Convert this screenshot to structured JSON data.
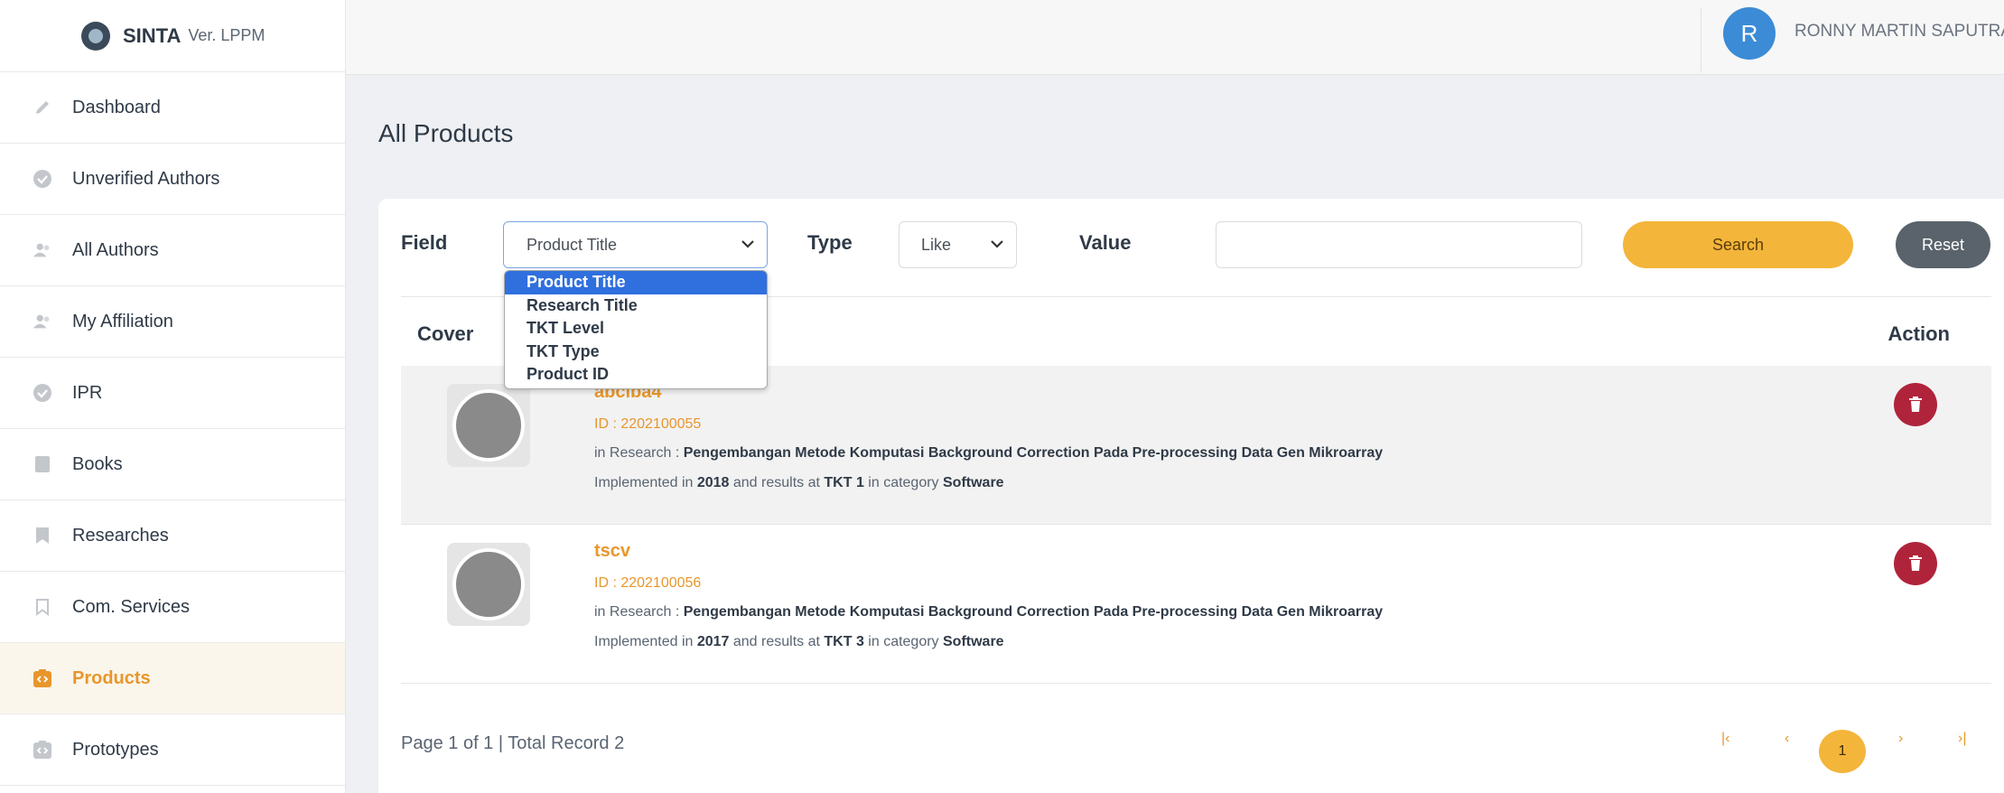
{
  "brand": {
    "name": "SINTA",
    "version": "Ver. LPPM"
  },
  "sidebar": {
    "items": [
      {
        "label": "Dashboard",
        "icon": "pencil-icon"
      },
      {
        "label": "Unverified Authors",
        "icon": "badge-check-icon"
      },
      {
        "label": "All Authors",
        "icon": "users-icon"
      },
      {
        "label": "My Affiliation",
        "icon": "users-icon"
      },
      {
        "label": "IPR",
        "icon": "badge-check-icon"
      },
      {
        "label": "Books",
        "icon": "book-icon"
      },
      {
        "label": "Researches",
        "icon": "bookmark-icon"
      },
      {
        "label": "Com. Services",
        "icon": "bookmark-outline-icon"
      },
      {
        "label": "Products",
        "icon": "code-box-icon",
        "active": true
      },
      {
        "label": "Prototypes",
        "icon": "code-box-icon"
      }
    ]
  },
  "header": {
    "avatar_letter": "R",
    "user_name": "RONNY MARTIN SAPUTRA,"
  },
  "page": {
    "title": "All Products"
  },
  "filter": {
    "field_label": "Field",
    "field_value": "Product Title",
    "field_options": [
      "Product Title",
      "Research Title",
      "TKT Level",
      "TKT Type",
      "Product ID"
    ],
    "type_label": "Type",
    "type_value": "Like",
    "value_label": "Value",
    "value_text": "",
    "search_label": "Search",
    "reset_label": "Reset"
  },
  "table": {
    "headers": {
      "cover": "Cover",
      "action": "Action"
    },
    "rows": [
      {
        "title": "abciba4",
        "id": "ID : 2202100055",
        "research_prefix": "in Research : ",
        "research": "Pengembangan Metode Komputasi Background Correction Pada Pre-processing Data Gen Mikroarray",
        "impl_prefix": "Implemented in ",
        "year": "2018",
        "impl_mid": " and results at ",
        "tkt": "TKT 1",
        "impl_cat": " in category ",
        "category": "Software"
      },
      {
        "title": "tscv",
        "id": "ID : 2202100056",
        "research_prefix": "in Research : ",
        "research": "Pengembangan Metode Komputasi Background Correction Pada Pre-processing Data Gen Mikroarray",
        "impl_prefix": "Implemented in ",
        "year": "2017",
        "impl_mid": " and results at ",
        "tkt": "TKT 3",
        "impl_cat": " in category ",
        "category": "Software"
      }
    ]
  },
  "pagination": {
    "summary": "Page 1 of 1 | Total Record 2",
    "first": "|‹",
    "prev": "‹",
    "current": "1",
    "next": "›",
    "last": "›|"
  },
  "colors": {
    "accent": "#e8962b",
    "search": "#f3b53a",
    "reset": "#5a636b",
    "delete": "#b0243b",
    "avatar": "#3b8bd6"
  }
}
